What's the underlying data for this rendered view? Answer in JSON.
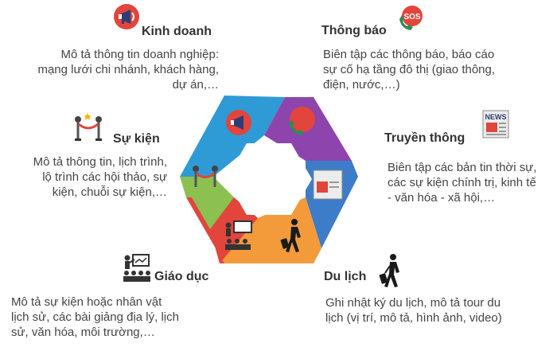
{
  "sections": {
    "business": {
      "title": "Kinh doanh",
      "desc": "Mô tả thông tin doanh nghiệp:\nmạng lưới chi nhánh, khách hàng,\ndự án,…",
      "icon": "megaphone-icon"
    },
    "notice": {
      "title": "Thông báo",
      "desc": "Biên tập các thông báo, báo cáo\nsự cố hạ tầng đô thị (giao thông,\nđiện, nước,…)",
      "icon": "sos-phone-icon"
    },
    "events": {
      "title": "Sự kiện",
      "desc": "Mô tả thông tin, lịch trình,\nlộ trình các hội thảo, sự\nkiện, chuỗi sự kiện,…",
      "icon": "red-carpet-icon"
    },
    "media": {
      "title": "Truyền thông",
      "desc": "Biên tập các bản tin thời sự,\ncác sự kiện chính trị, kinh tế\n- văn hóa - xã hội,…",
      "icon": "news-icon"
    },
    "education": {
      "title": "Giáo dục",
      "desc": "Mô tả sự kiện hoặc nhân vật\nlịch sử, các bài giảng địa lý, lịch\nsử, văn hóa, môi trường,…",
      "icon": "classroom-icon"
    },
    "travel": {
      "title": "Du lịch",
      "desc": "Ghi nhật ký du lịch, mô tả tour du\nlịch (vị trí, mô tả, hình ảnh, video)",
      "icon": "traveler-icon"
    }
  },
  "hexagon_colors": {
    "top_left": "#2E9BD6",
    "top_right": "#8E44AD",
    "right": "#3D7CC9",
    "bottom_right": "#F39A3B",
    "bottom_left": "#E2453C",
    "left": "#8CC152"
  },
  "small_icons": {
    "news_label": "NEWS",
    "sos_label": "SOS"
  }
}
